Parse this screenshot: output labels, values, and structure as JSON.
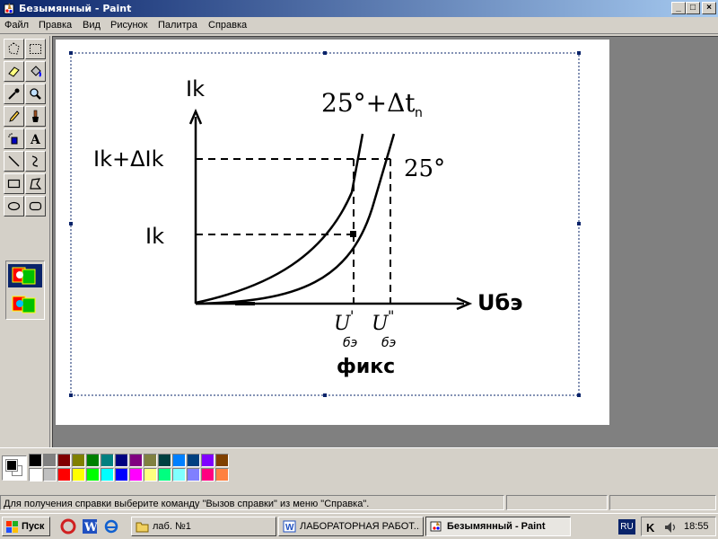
{
  "window": {
    "title": "Безымянный - Paint",
    "controls": {
      "minimize": "_",
      "maximize": "□",
      "close": "×"
    }
  },
  "menu": [
    "Файл",
    "Правка",
    "Вид",
    "Рисунок",
    "Палитра",
    "Справка"
  ],
  "tools": [
    "free-select",
    "rect-select",
    "eraser",
    "fill",
    "color-picker",
    "magnifier",
    "pencil",
    "brush",
    "airbrush",
    "text",
    "line",
    "curve",
    "rectangle",
    "polygon",
    "ellipse",
    "rounded-rectangle"
  ],
  "drawing": {
    "y_label": "Ik",
    "ik_delta_label": "Ik+ΔIk",
    "ik_label": "Ik",
    "curve_hot_label": "25°+Δt",
    "curve_hot_sub": "n",
    "curve_base_label": "25°",
    "x_label": "Uбэ",
    "u1_main": "U",
    "u1_sup": "'",
    "u1_sub": "бэ",
    "u2_main": "U",
    "u2_sup": "\"",
    "u2_sub": "бэ",
    "fixed_label": "фикс"
  },
  "palette": {
    "foreground": "#000000",
    "background": "#ffffff",
    "row1": [
      "#000000",
      "#808080",
      "#800000",
      "#808000",
      "#008000",
      "#008080",
      "#000080",
      "#800080",
      "#808040",
      "#004040",
      "#0080ff",
      "#004080",
      "#8000ff",
      "#804000"
    ],
    "row2": [
      "#ffffff",
      "#c0c0c0",
      "#ff0000",
      "#ffff00",
      "#00ff00",
      "#00ffff",
      "#0000ff",
      "#ff00ff",
      "#ffff80",
      "#00ff80",
      "#80ffff",
      "#8080ff",
      "#ff0080",
      "#ff8040"
    ]
  },
  "status": {
    "help_text": "Для получения справки выберите команду \"Вызов справки\" из меню \"Справка\"."
  },
  "taskbar": {
    "start_label": "Пуск",
    "tasks": [
      {
        "label": "лаб. №1",
        "icon": "folder-icon",
        "active": false
      },
      {
        "label": "ЛАБОРАТОРНАЯ РАБОТ...",
        "icon": "word-icon",
        "active": false
      },
      {
        "label": "Безымянный - Paint",
        "icon": "paint-icon",
        "active": true
      }
    ],
    "language": "RU",
    "clock": "18:55"
  }
}
